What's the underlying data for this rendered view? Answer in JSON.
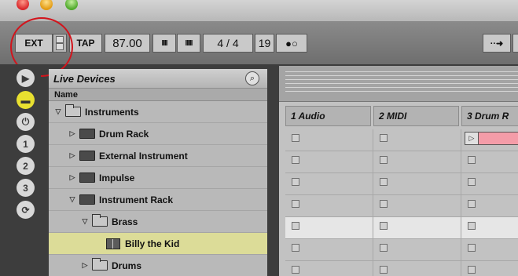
{
  "window": {
    "traffic_lights": [
      "close",
      "minimize",
      "zoom"
    ]
  },
  "transport": {
    "ext_label": "EXT",
    "tap_label": "TAP",
    "tempo": "87.00",
    "nudge_down": "IIII",
    "nudge_up": "IIIII",
    "time_signature": "4 / 4",
    "bars": "19",
    "metronome": "●○",
    "follow": "··➜"
  },
  "sidebar_icons": [
    {
      "name": "play-icon",
      "glyph": "▶"
    },
    {
      "name": "live-devices-icon",
      "glyph": "▬"
    },
    {
      "name": "plugin-icon",
      "glyph": "⏻"
    },
    {
      "name": "places-1-icon",
      "glyph": "1"
    },
    {
      "name": "places-2-icon",
      "glyph": "2"
    },
    {
      "name": "places-3-icon",
      "glyph": "3"
    },
    {
      "name": "refresh-icon",
      "glyph": "⟳"
    }
  ],
  "browser": {
    "title": "Live Devices",
    "search_glyph": "⌕",
    "column_header": "Name",
    "rows": [
      {
        "label": "Instruments",
        "arrow": "▽",
        "icon": "folder-open",
        "indent": 0
      },
      {
        "label": "Drum Rack",
        "arrow": "▷",
        "icon": "folder",
        "indent": 1
      },
      {
        "label": "External Instrument",
        "arrow": "▷",
        "icon": "folder",
        "indent": 1
      },
      {
        "label": "Impulse",
        "arrow": "▷",
        "icon": "folder",
        "indent": 1
      },
      {
        "label": "Instrument Rack",
        "arrow": "▽",
        "icon": "folder",
        "indent": 1
      },
      {
        "label": "Brass",
        "arrow": "▽",
        "icon": "folder-open",
        "indent": 2
      },
      {
        "label": "Billy the Kid",
        "arrow": "",
        "icon": "device",
        "indent": 3,
        "selected": true
      },
      {
        "label": "Drums",
        "arrow": "▷",
        "icon": "folder-open",
        "indent": 2
      }
    ]
  },
  "session": {
    "tracks": [
      {
        "name": "1 Audio"
      },
      {
        "name": "2 MIDI"
      },
      {
        "name": "3 Drum R"
      }
    ],
    "clip_color": "#f49ca8"
  },
  "annotation_color": "#d2141c"
}
